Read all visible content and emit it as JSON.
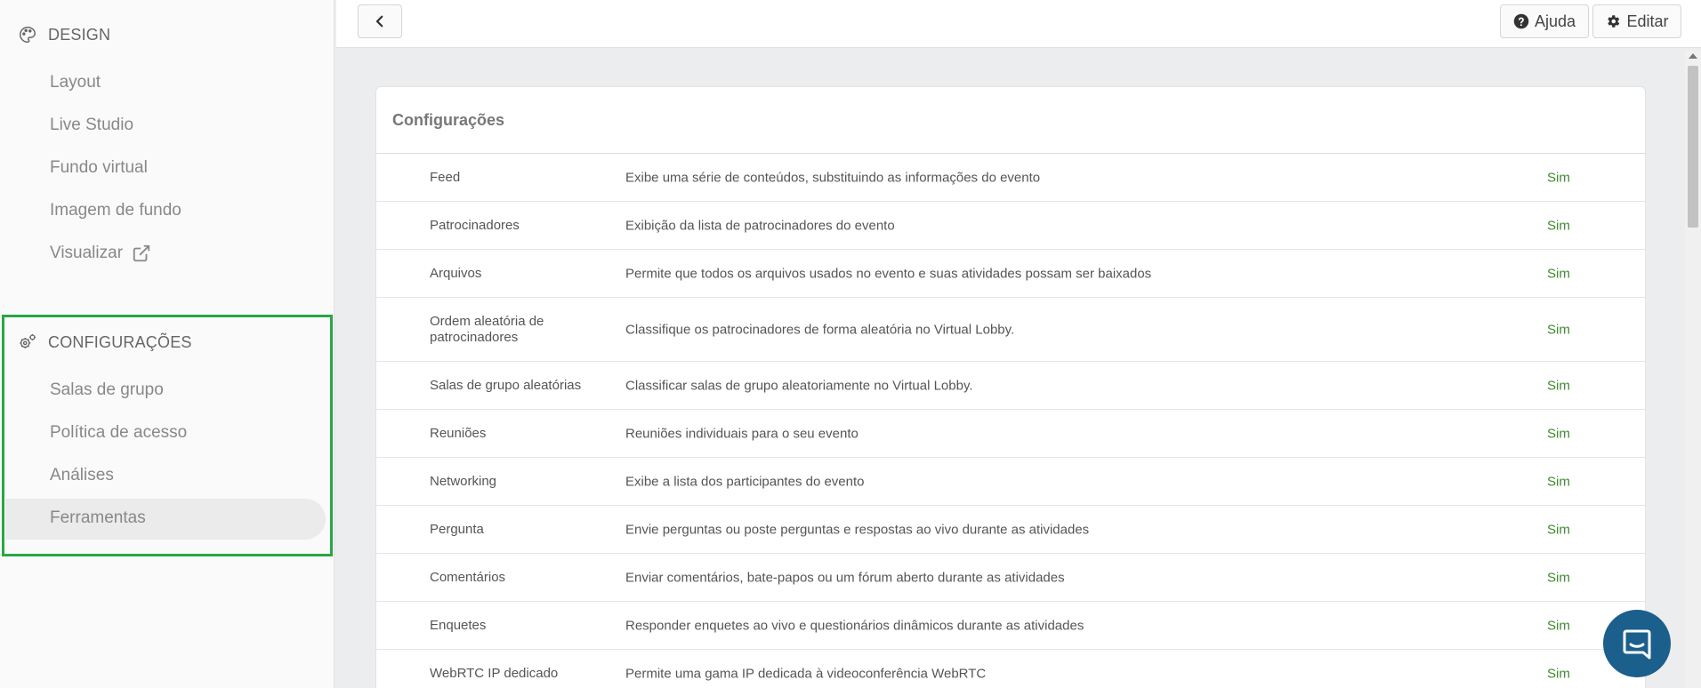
{
  "sidebar": {
    "design": {
      "title": "DESIGN",
      "icon": "palette-icon",
      "items": [
        {
          "label": "Layout"
        },
        {
          "label": "Live Studio"
        },
        {
          "label": "Fundo virtual"
        },
        {
          "label": "Imagem de fundo"
        },
        {
          "label": "Visualizar",
          "icon": "external-link-icon"
        }
      ]
    },
    "config": {
      "title": "CONFIGURAÇÕES",
      "icon": "gears-icon",
      "items": [
        {
          "label": "Salas de grupo"
        },
        {
          "label": "Política de acesso"
        },
        {
          "label": "Análises"
        },
        {
          "label": "Ferramentas",
          "active": true
        }
      ]
    }
  },
  "topbar": {
    "back_icon": "chevron-left-icon",
    "help_label": "Ajuda",
    "edit_label": "Editar"
  },
  "card": {
    "title": "Configurações",
    "rows": [
      {
        "name": "Feed",
        "desc": "Exibe uma série de conteúdos, substituindo as informações do evento",
        "value": "Sim"
      },
      {
        "name": "Patrocinadores",
        "desc": "Exibição da lista de patrocinadores do evento",
        "value": "Sim"
      },
      {
        "name": "Arquivos",
        "desc": "Permite que todos os arquivos usados no evento e suas atividades possam ser baixados",
        "value": "Sim"
      },
      {
        "name": "Ordem aleatória de patrocinadores",
        "desc": "Classifique os patrocinadores de forma aleatória no Virtual Lobby.",
        "value": "Sim"
      },
      {
        "name": "Salas de grupo aleatórias",
        "desc": "Classificar salas de grupo aleatoriamente no Virtual Lobby.",
        "value": "Sim"
      },
      {
        "name": "Reuniões",
        "desc": "Reuniões individuais para o seu evento",
        "value": "Sim"
      },
      {
        "name": "Networking",
        "desc": "Exibe a lista dos participantes do evento",
        "value": "Sim"
      },
      {
        "name": "Pergunta",
        "desc": "Envie perguntas ou poste perguntas e respostas ao vivo durante as atividades",
        "value": "Sim"
      },
      {
        "name": "Comentários",
        "desc": "Enviar comentários, bate-papos ou um fórum aberto durante as atividades",
        "value": "Sim"
      },
      {
        "name": "Enquetes",
        "desc": "Responder enquetes ao vivo e questionários dinâmicos durante as atividades",
        "value": "Sim"
      },
      {
        "name": "WebRTC IP dedicado",
        "desc": "Permite uma gama IP dedicada à videoconferência WebRTC",
        "value": "Sim"
      }
    ]
  },
  "colors": {
    "accent_green": "#27a745",
    "value_green": "#3c8a2e",
    "chat_blue": "#1b5f8c"
  }
}
